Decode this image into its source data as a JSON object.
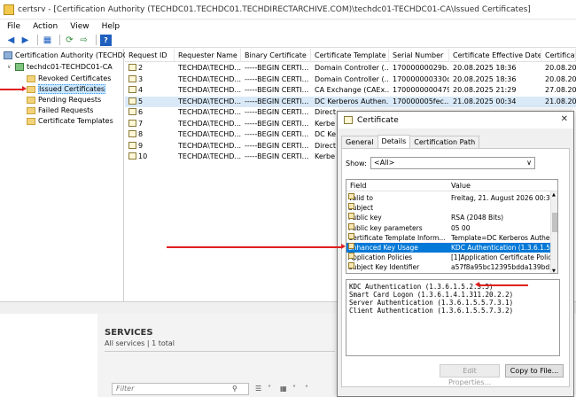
{
  "window": {
    "title": "certsrv - [Certification Authority (TECHDC01.TECHDC01.TECHDIRECTARCHIVE.COM)\\techdc01-TECHDC01-CA\\Issued Certificates]"
  },
  "menu": [
    "File",
    "Action",
    "View",
    "Help"
  ],
  "tree": {
    "root": "Certification Authority (TECHDC0",
    "ca": "techdc01-TECHDC01-CA",
    "items": [
      "Revoked Certificates",
      "Issued Certificates",
      "Pending Requests",
      "Failed Requests",
      "Certificate Templates"
    ]
  },
  "list": {
    "columns": [
      "Request ID",
      "Requester Name",
      "Binary Certificate",
      "Certificate Template",
      "Serial Number",
      "Certificate Effective Date",
      "Certificate"
    ],
    "rows": [
      [
        "2",
        "TECHDA\\TECHD...",
        "-----BEGIN CERTI...",
        "Domain Controller (...",
        "17000000029b...",
        "20.08.2025 18:36",
        "20.08.202"
      ],
      [
        "3",
        "TECHDA\\TECHD...",
        "-----BEGIN CERTI...",
        "Domain Controller (...",
        "170000000330d...",
        "20.08.2025 18:36",
        "20.08.202"
      ],
      [
        "4",
        "TECHDA\\TECHD...",
        "-----BEGIN CERTI...",
        "CA Exchange (CAEx...",
        "17000000004793...",
        "20.08.2025 21:29",
        "27.08.202"
      ],
      [
        "5",
        "TECHDA\\TECHD...",
        "-----BEGIN CERTI...",
        "DC Kerberos Authen...",
        "170000005fec...",
        "21.08.2025 00:34",
        "21.08.202"
      ],
      [
        "6",
        "TECHDA\\TECHD...",
        "-----BEGIN CERTI...",
        "Direct",
        "",
        "",
        ""
      ],
      [
        "7",
        "TECHDA\\TECHD...",
        "-----BEGIN CERTI...",
        "Kerbe",
        "",
        "",
        ""
      ],
      [
        "8",
        "TECHDA\\TECHD...",
        "-----BEGIN CERTI...",
        "DC Ke",
        "",
        "",
        ""
      ],
      [
        "9",
        "TECHDA\\TECHD...",
        "-----BEGIN CERTI...",
        "Direct",
        "",
        "",
        ""
      ],
      [
        "10",
        "TECHDA\\TECHD...",
        "-----BEGIN CERTI...",
        "Kerbe",
        "",
        "",
        ""
      ]
    ]
  },
  "services": {
    "title": "SERVICES",
    "subtitle": "All services | 1 total",
    "filter_placeholder": "Filter"
  },
  "dialog": {
    "title": "Certificate",
    "tabs": [
      "General",
      "Details",
      "Certification Path"
    ],
    "show_label": "Show:",
    "show_value": "<All>",
    "grid_headers": [
      "Field",
      "Value"
    ],
    "fields": [
      [
        "Valid to",
        "Freitag, 21. August 2026 00:3..."
      ],
      [
        "Subject",
        ""
      ],
      [
        "Public key",
        "RSA (2048 Bits)"
      ],
      [
        "Public key parameters",
        "05 00"
      ],
      [
        "Certificate Template Inform...",
        "Template=DC Kerberos Authe..."
      ],
      [
        "Enhanced Key Usage",
        "KDC Authentication (1.3.6.1.5..."
      ],
      [
        "Application Policies",
        "[1]Application Certificate Polic..."
      ],
      [
        "Subject Key Identifier",
        "a57f8a95bc12395bdda139bd5..."
      ]
    ],
    "value_lines": [
      "KDC Authentication (1.3.6.1.5.2.3.5)",
      "Smart Card Logon (1.3.6.1.4.1.311.20.2.2)",
      "Server Authentication (1.3.6.1.5.5.7.3.1)",
      "Client Authentication (1.3.6.1.5.5.7.3.2)"
    ],
    "edit_properties": "Edit Properties...",
    "copy_to_file": "Copy to File..."
  },
  "colors": {
    "selection": "#0078d7",
    "arrow": "#e02020",
    "tree_selection": "#cce8ff"
  }
}
